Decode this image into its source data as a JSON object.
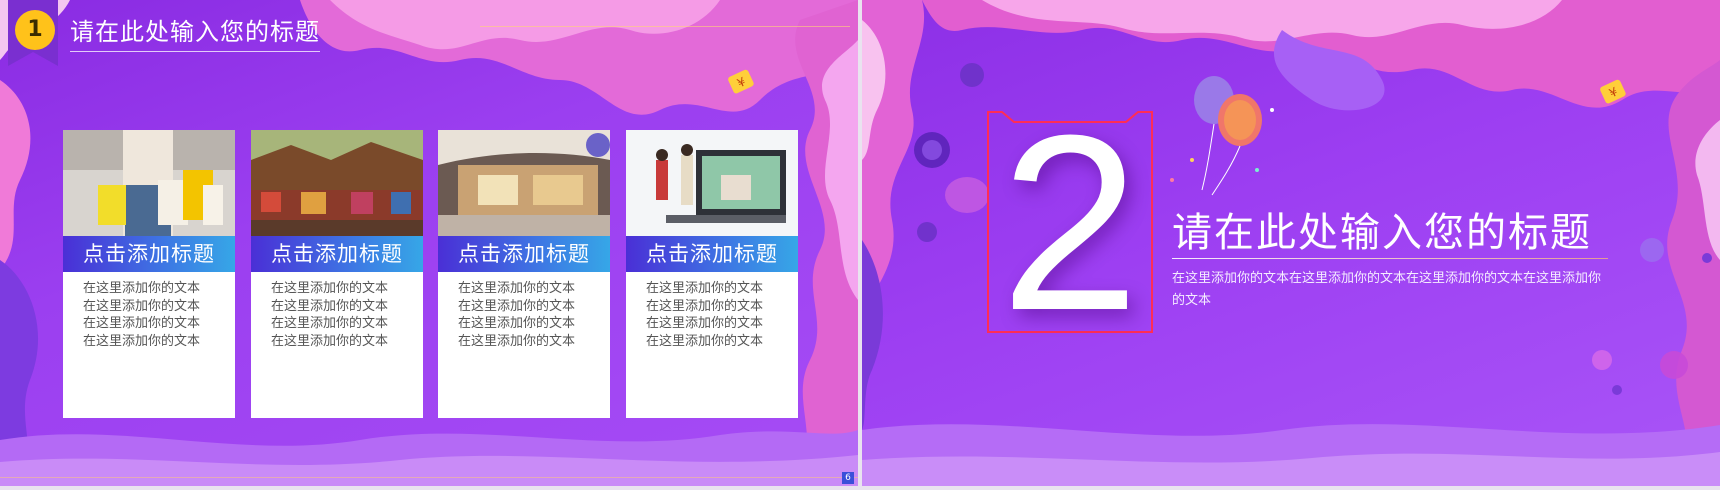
{
  "left_slide": {
    "badge_number": "1",
    "header_title": "请在此处输入您的标题",
    "page_number": "6",
    "cards": [
      {
        "photo": "shopping-bags-photo",
        "title": "点击添加标题",
        "lines": [
          "在这里添加你的文本",
          "在这里添加你的文本",
          "在这里添加你的文本",
          "在这里添加你的文本"
        ]
      },
      {
        "photo": "market-street-photo",
        "title": "点击添加标题",
        "lines": [
          "在这里添加你的文本",
          "在这里添加你的文本",
          "在这里添加你的文本",
          "在这里添加你的文本"
        ]
      },
      {
        "photo": "shopping-mall-photo",
        "title": "点击添加标题",
        "lines": [
          "在这里添加你的文本",
          "在这里添加你的文本",
          "在这里添加你的文本",
          "在这里添加你的文本"
        ]
      },
      {
        "photo": "online-shopping-photo",
        "title": "点击添加标题",
        "lines": [
          "在这里添加你的文本",
          "在这里添加你的文本",
          "在这里添加你的文本",
          "在这里添加你的文本"
        ]
      }
    ]
  },
  "right_slide": {
    "big_number": "2",
    "title": "请在此处输入您的标题",
    "description": "在这里添加你的文本在这里添加你的文本在这里添加你的文本在这里添加你的文本"
  },
  "colors": {
    "background_purple": "#9b3ff0",
    "accent_pink": "#f06ad0",
    "badge_yellow": "#ffc21a",
    "card_title_gradient_start": "#4a2fd6",
    "card_title_gradient_end": "#36a7e7",
    "frame_red": "#ff2d55"
  },
  "icons": {
    "badge": "yellow-circle-badge",
    "coin": "yen-coin-icon",
    "balloons": "balloons-icon"
  }
}
